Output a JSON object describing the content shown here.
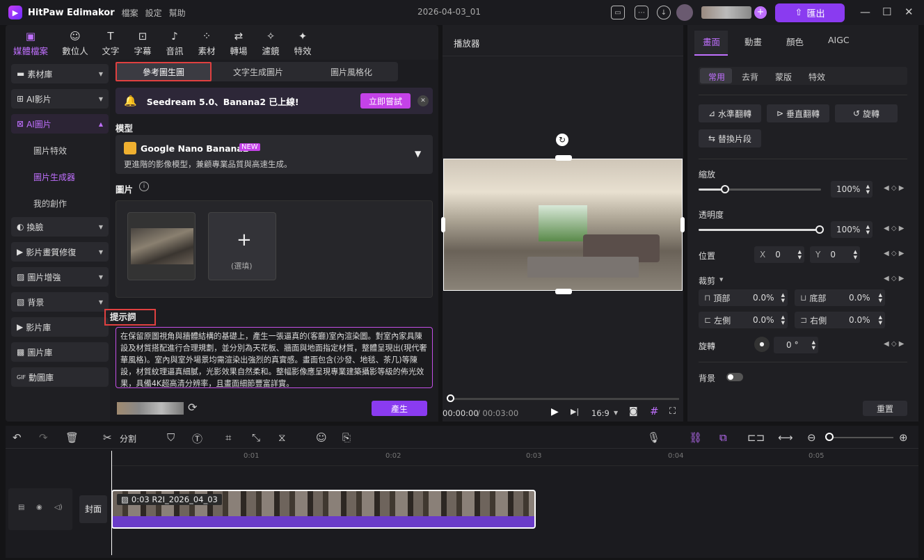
{
  "app": {
    "name": "HitPaw Edimakor",
    "menus": [
      "檔案",
      "設定",
      "幫助"
    ],
    "doc_title": "2026-04-03_01",
    "export": "匯出"
  },
  "tools": [
    {
      "label": "媒體檔案",
      "icon": "media-icon"
    },
    {
      "label": "數位人",
      "icon": "avatar-add-icon"
    },
    {
      "label": "文字",
      "icon": "text-icon"
    },
    {
      "label": "字幕",
      "icon": "subtitle-icon"
    },
    {
      "label": "音訊",
      "icon": "music-icon"
    },
    {
      "label": "素材",
      "icon": "material-icon"
    },
    {
      "label": "轉場",
      "icon": "transition-icon"
    },
    {
      "label": "濾鏡",
      "icon": "filter-icon"
    },
    {
      "label": "特效",
      "icon": "effect-icon"
    }
  ],
  "sidebar": {
    "items": [
      {
        "label": "素材庫"
      },
      {
        "label": "AI影片"
      },
      {
        "label": "AI圖片"
      },
      {
        "label": "換臉"
      },
      {
        "label": "影片畫質修復"
      },
      {
        "label": "圖片增強"
      },
      {
        "label": "背景"
      },
      {
        "label": "影片庫"
      },
      {
        "label": "圖片庫"
      },
      {
        "label": "動圖庫"
      }
    ],
    "subitems": [
      "圖片特效",
      "圖片生成器",
      "我的創作"
    ]
  },
  "content": {
    "tabs": [
      "參考圖生圖",
      "文字生成圖片",
      "圖片風格化"
    ],
    "banner": {
      "text": "Seedream 5.0、Banana2 已上線!",
      "button": "立即嘗試"
    },
    "model_label": "模型",
    "model_name": "Google Nano Banana2",
    "model_badge": "NEW",
    "model_desc": "更進階的影像模型，兼顧專業品質與高速生成。",
    "image_label": "圖片",
    "optional": "(選填)",
    "prompt_label": "提示詞",
    "prompt": "在保留原圖視角與牆體結構的基礎上，產生一張逼真的(客廳)室內渲染圖。對室內家具陳設及材質搭配進行合理規劃，並分別為天花板、牆面與地面指定材質，整體呈現出(現代奢華風格)。室內與室外場景均需渲染出強烈的真實感。畫面包含(沙發、地毯、茶几)等陳設，材質紋理逼真細膩，光影效果自然柔和。整幅影像應呈現專業建築攝影等級的佈光效果，具備4K超高清分辨率，且畫面細節豐富詳實。",
    "generate": "產生"
  },
  "player": {
    "title": "播放器",
    "time_current": "00:00:00",
    "time_total": "/ 00:03:00",
    "ratio": "16:9"
  },
  "right": {
    "tabs": [
      "畫面",
      "動畫",
      "顏色",
      "AIGC"
    ],
    "subtabs": [
      "常用",
      "去背",
      "蒙版",
      "特效"
    ],
    "buttons": [
      "水準翻轉",
      "垂直翻轉",
      "旋轉",
      "替換片段"
    ],
    "scale_label": "縮放",
    "scale_value": "100%",
    "opacity_label": "透明度",
    "opacity_value": "100%",
    "position_label": "位置",
    "x_label": "X",
    "x_value": "0",
    "y_label": "Y",
    "y_value": "0",
    "crop_label": "裁剪",
    "crop": [
      {
        "label": "頂部",
        "value": "0.0%"
      },
      {
        "label": "底部",
        "value": "0.0%"
      },
      {
        "label": "左側",
        "value": "0.0%"
      },
      {
        "label": "右側",
        "value": "0.0%"
      }
    ],
    "rotate_label": "旋轉",
    "rotate_value": "0",
    "bg_label": "背景",
    "reset": "重置"
  },
  "timeline": {
    "split": "分割",
    "ticks": [
      "0:01",
      "0:02",
      "0:03",
      "0:04",
      "0:05"
    ],
    "cover": "封面",
    "clip_label": "0:03  R2I_2026_04_03"
  }
}
